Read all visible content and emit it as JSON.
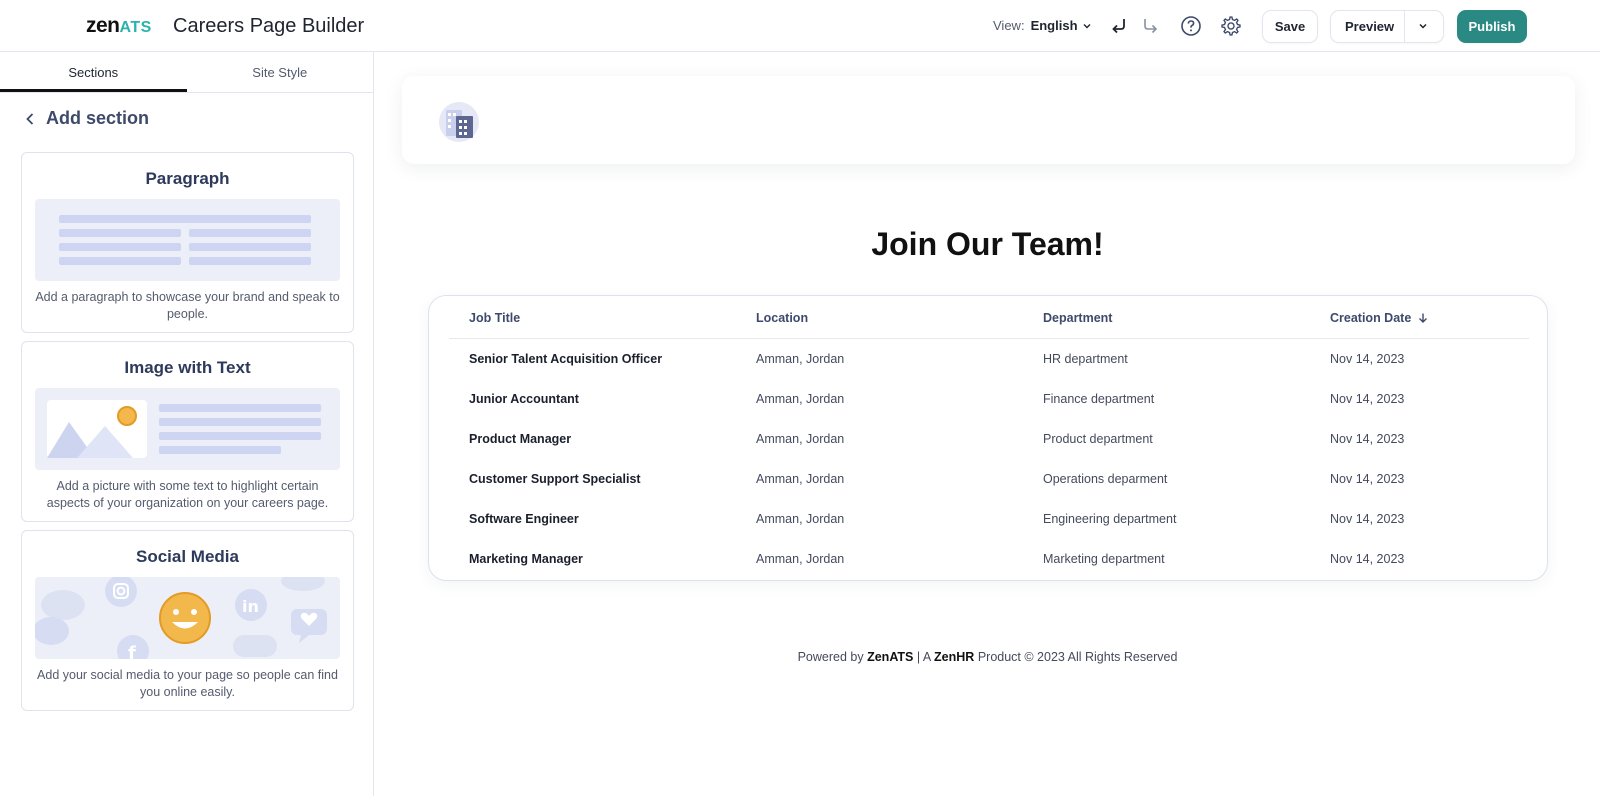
{
  "app": {
    "logo_main": "zen",
    "logo_accent": "ATS",
    "title": "Careers Page Builder"
  },
  "toolbar": {
    "view_label": "View:",
    "view_value": "English",
    "save_label": "Save",
    "preview_label": "Preview",
    "publish_label": "Publish",
    "accent_color": "#2a8a83"
  },
  "sidebar": {
    "tabs": [
      {
        "label": "Sections",
        "active": true
      },
      {
        "label": "Site Style",
        "active": false
      }
    ],
    "back_label": "Add section",
    "cards": [
      {
        "title": "Paragraph",
        "desc": "Add a paragraph to showcase your brand and speak to people."
      },
      {
        "title": "Image with Text",
        "desc": "Add a picture with some text to highlight certain aspects of your organization on your careers page."
      },
      {
        "title": "Social Media",
        "desc": "Add your social media to your page so people can find you online easily."
      }
    ]
  },
  "main": {
    "heading": "Join Our Team!",
    "columns": [
      "Job Title",
      "Location",
      "Department",
      "Creation Date"
    ],
    "jobs": [
      {
        "title": "Senior Talent Acquisition Officer",
        "location": "Amman, Jordan",
        "department": "HR department",
        "date": "Nov 14, 2023"
      },
      {
        "title": "Junior Accountant",
        "location": "Amman, Jordan",
        "department": "Finance department",
        "date": "Nov 14, 2023"
      },
      {
        "title": "Product Manager",
        "location": "Amman, Jordan",
        "department": "Product department",
        "date": "Nov 14, 2023"
      },
      {
        "title": "Customer Support Specialist",
        "location": "Amman, Jordan",
        "department": "Operations deparment",
        "date": "Nov 14, 2023"
      },
      {
        "title": "Software Engineer",
        "location": "Amman, Jordan",
        "department": "Engineering department",
        "date": "Nov 14, 2023"
      },
      {
        "title": "Marketing Manager",
        "location": "Amman, Jordan",
        "department": "Marketing department",
        "date": "Nov 14, 2023"
      }
    ],
    "footer": {
      "powered": "Powered by",
      "brand": "ZenATS",
      "sep": "| A",
      "company": "ZenHR",
      "rest": "Product © 2023 All Rights Reserved"
    }
  }
}
